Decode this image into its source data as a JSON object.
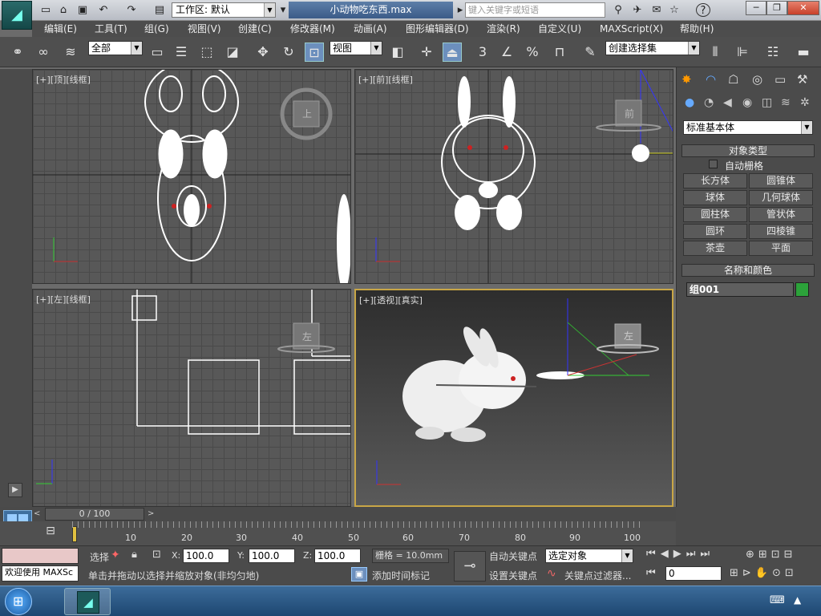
{
  "titlebar": {
    "workspace_label": "工作区: 默认",
    "filename": "小动物吃东西.max",
    "search_placeholder": "键入关键字或短语"
  },
  "menu": [
    "编辑(E)",
    "工具(T)",
    "组(G)",
    "视图(V)",
    "创建(C)",
    "修改器(M)",
    "动画(A)",
    "图形编辑器(D)",
    "渲染(R)",
    "自定义(U)",
    "MAXScript(X)",
    "帮助(H)"
  ],
  "toolbar": {
    "selection_filter": "全部",
    "ref_coord": "视图",
    "named_selection": "创建选择集",
    "snap_angle": "3",
    "snap_percent": "%"
  },
  "viewports": {
    "top": {
      "label": "[+][顶][线框]",
      "cube": "上"
    },
    "front": {
      "label": "[+][前][线框]",
      "cube": "前"
    },
    "left": {
      "label": "[+][左][线框]",
      "cube": "左"
    },
    "perspective": {
      "label": "[+][透视][真实]",
      "cube": "左"
    }
  },
  "command_panel": {
    "category": "标准基本体",
    "object_type_title": "对象类型",
    "autogrid": "自动栅格",
    "buttons": [
      "长方体",
      "圆锥体",
      "球体",
      "几何球体",
      "圆柱体",
      "管状体",
      "圆环",
      "四棱锥",
      "茶壶",
      "平面"
    ],
    "name_color_title": "名称和颜色",
    "object_name": "组001",
    "object_color": "#2ca23a"
  },
  "timeline": {
    "frame_display": "0 / 100",
    "ticks": [
      "10",
      "20",
      "30",
      "40",
      "50",
      "60",
      "70",
      "80",
      "90",
      "100"
    ]
  },
  "status": {
    "welcome": "欢迎使用 MAXSc",
    "select_label": "选择",
    "prompt": "单击并拖动以选择并缩放对象(非均匀地)",
    "x_label": "X:",
    "x": "100.0",
    "y_label": "Y:",
    "y": "100.0",
    "z_label": "Z:",
    "z": "100.0",
    "grid": "栅格 = 10.0mm",
    "add_time_tag": "添加时间标记",
    "auto_key": "自动关键点",
    "set_key": "设置关键点",
    "selected_object": "选定对象",
    "key_filters": "关键点过滤器...",
    "frame": "0"
  },
  "colors": {
    "accent": "#c8a646",
    "viewport_bg": "#585858",
    "selected_blue": "#6c8fbd"
  }
}
